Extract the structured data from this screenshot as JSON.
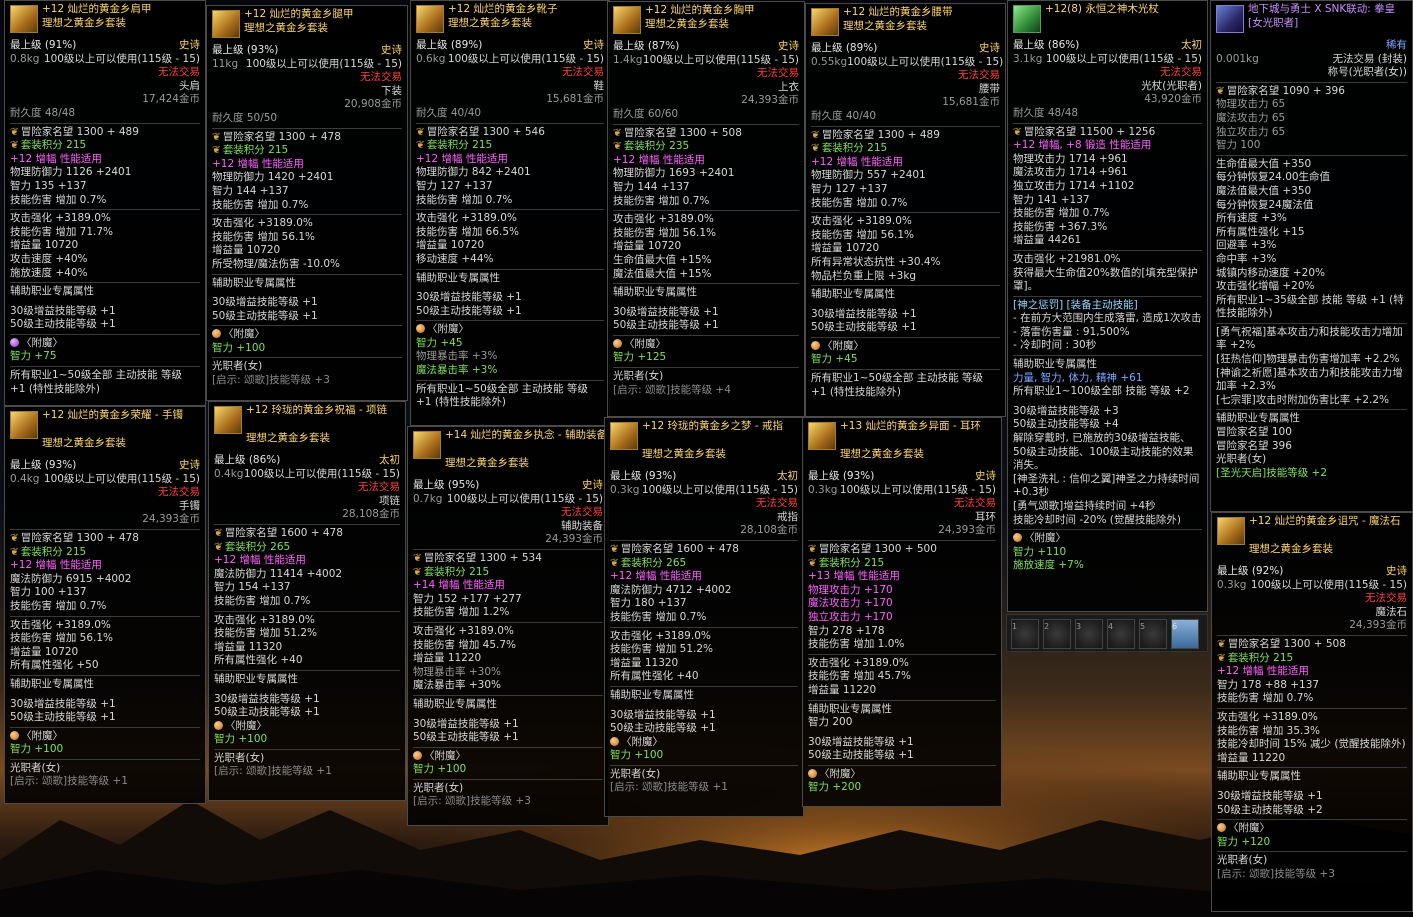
{
  "tooltips": [
    {
      "id": "shoulder",
      "name": "+12 灿烂的黄金乡肩甲",
      "set": "理想之黄金乡套装",
      "icon": "gold-armor-icon",
      "rarity": "史诗",
      "grade": "最上级 (91%)",
      "weight": "0.8kg",
      "level_req": "100级以上可以使用(115级 - 15)",
      "trade": "无法交易",
      "slot": "头肩",
      "price": "17,424金币",
      "durability": "耐久度 48/48",
      "fame": "冒险家名望 1300 + 489",
      "setpoints": "套装积分 215",
      "enhance": "+12 增幅 性能适用",
      "defense": "物理防御力 1126 +2401",
      "int": "智力 135 +137",
      "skill_dmg": "技能伤害 增加 0.7%",
      "stats": [
        "攻击强化 +3189.0%",
        "技能伤害 增加 71.7%",
        "增益量 10720",
        "攻击速度 +40%",
        "施放速度 +40%"
      ],
      "buffer_title": "辅助职业专属属性",
      "buffer": [
        "30级增益技能等级 +1",
        "50级主动技能等级 +1"
      ],
      "enchant": "〈附魔〉",
      "enchant_val": "智力 +75",
      "extra": "所有职业1~50级全部 主动技能 等级 +1 (特性技能除外)",
      "class": "",
      "hint": ""
    },
    {
      "id": "legs",
      "name": "+12 灿烂的黄金乡腿甲",
      "set": "理想之黄金乡套装",
      "rarity": "史诗",
      "grade": "最上级 (93%)",
      "weight": "11kg",
      "level_req": "100级以上可以使用(115级 - 15)",
      "trade": "无法交易",
      "slot": "下装",
      "price": "20,908金币",
      "durability": "耐久度 50/50",
      "fame": "冒险家名望 1300 + 478",
      "setpoints": "套装积分 215",
      "enhance": "+12 增幅 性能适用",
      "defense": "物理防御力 1420 +2401",
      "int": "智力 144 +137",
      "skill_dmg": "技能伤害 增加 0.7%",
      "stats": [
        "攻击强化 +3189.0%",
        "技能伤害 增加 56.1%",
        "增益量 10720",
        "所受物理/魔法伤害 -10.0%"
      ],
      "buffer_title": "辅助职业专属属性",
      "buffer": [
        "30级增益技能等级 +1",
        "50级主动技能等级 +1"
      ],
      "enchant": "〈附魔〉",
      "enchant_val": "智力 +100",
      "class": "光职者(女)",
      "hint": "[启示: 颂歌]技能等级 +3"
    },
    {
      "id": "boots",
      "name": "+12 灿烂的黄金乡靴子",
      "set": "理想之黄金乡套装",
      "rarity": "史诗",
      "grade": "最上级 (89%)",
      "weight": "0.6kg",
      "level_req": "100级以上可以使用(115级 - 15)",
      "trade": "无法交易",
      "slot": "鞋",
      "price": "15,681金币",
      "durability": "耐久度 40/40",
      "fame": "冒险家名望 1300 + 546",
      "setpoints": "套装积分 215",
      "enhance": "+12 增幅 性能适用",
      "defense": "物理防御力 842 +2401",
      "int": "智力 127 +137",
      "skill_dmg": "技能伤害 增加 0.7%",
      "stats": [
        "攻击强化 +3189.0%",
        "技能伤害 增加 66.5%",
        "增益量 10720",
        "移动速度 +44%"
      ],
      "buffer_title": "辅助职业专属属性",
      "buffer": [
        "30级增益技能等级 +1",
        "50级主动技能等级 +1"
      ],
      "enchant": "〈附魔〉",
      "enchant_val": "智力 +45",
      "enchant_extra": [
        "物理暴击率 +3%",
        "魔法暴击率 +3%"
      ],
      "extra": "所有职业1~50级全部 主动技能 等级 +1 (特性技能除外)"
    },
    {
      "id": "chest",
      "name": "+12 灿烂的黄金乡胸甲",
      "set": "理想之黄金乡套装",
      "rarity": "史诗",
      "grade": "最上级 (87%)",
      "weight": "1.4kg",
      "level_req": "100级以上可以使用(115级 - 15)",
      "trade": "无法交易",
      "slot": "上衣",
      "price": "24,393金币",
      "durability": "耐久度 60/60",
      "fame": "冒险家名望 1300 + 508",
      "setpoints": "套装积分 235",
      "enhance": "+12 增幅 性能适用",
      "defense": "物理防御力 1693 +2401",
      "int": "智力 144 +137",
      "skill_dmg": "技能伤害 增加 0.7%",
      "stats": [
        "攻击强化 +3189.0%",
        "技能伤害 增加 56.1%",
        "增益量 10720",
        "生命值最大值 +15%",
        "魔法值最大值 +15%"
      ],
      "buffer_title": "辅助职业专属属性",
      "buffer": [
        "30级增益技能等级 +1",
        "50级主动技能等级 +1"
      ],
      "enchant": "〈附魔〉",
      "enchant_val": "智力 +125",
      "class": "光职者(女)",
      "hint": "[启示: 颂歌]技能等级 +4"
    },
    {
      "id": "belt",
      "name": "+12 灿烂的黄金乡腰带",
      "set": "理想之黄金乡套装",
      "rarity": "史诗",
      "grade": "最上级 (89%)",
      "weight": "0.55kg",
      "level_req": "100级以上可以使用(115级 - 15)",
      "trade": "无法交易",
      "slot": "腰带",
      "price": "15,681金币",
      "durability": "耐久度 40/40",
      "fame": "冒险家名望 1300 + 489",
      "setpoints": "套装积分 215",
      "enhance": "+12 增幅 性能适用",
      "defense": "物理防御力 557 +2401",
      "int": "智力 127 +137",
      "skill_dmg": "技能伤害 增加 0.7%",
      "stats": [
        "攻击强化 +3189.0%",
        "技能伤害 增加 56.1%",
        "增益量 10720",
        "所有异常状态抗性 +30.4%",
        "物品栏负重上限 +3kg"
      ],
      "buffer_title": "辅助职业专属属性",
      "buffer": [
        "30级增益技能等级 +1",
        "50级主动技能等级 +1"
      ],
      "enchant": "〈附魔〉",
      "enchant_val": "智力 +45",
      "extra": "所有职业1~50级全部 主动技能 等级 +1 (特性技能除外)"
    },
    {
      "id": "weapon",
      "name": "+12(8) 永恒之神木光杖",
      "rarity": "太初",
      "grade": "最上级 (86%)",
      "weight": "3.1kg",
      "level_req": "100级以上可以使用(115级 - 15)",
      "trade": "无法交易",
      "slot": "光杖(光职者)",
      "price": "43,920金币",
      "durability": "耐久度 48/48",
      "fame": "冒险家名望 11500 + 1256",
      "enhance": "+12 增幅, +8 锻造 性能适用",
      "atk": [
        "物理攻击力 1714 +961",
        "魔法攻击力 1714 +961",
        "独立攻击力 1714 +1102"
      ],
      "int": "智力 141 +137",
      "skill_dmg": "技能伤害 增加 0.7%",
      "skill_dmg2": "技能伤害 +367.3%",
      "buff": "增益量 44261",
      "stats": [
        "攻击强化 +21981.0%",
        "获得最大生命值20%数值的[填充型保护罩]。"
      ],
      "active_title": "[神之惩罚] [装备主动技能]",
      "active": [
        "- 在前方大范围内生成落雷, 造成1次攻击",
        "- 落雷伤害量 : 91,500%",
        "- 冷却时间 : 30秒"
      ],
      "buffer_title": "辅助职业专属属性",
      "buffer_stat": "力量, 智力, 体力, 精神 +61",
      "buffer_skill": "所有职业1~100级全部 技能 等级 +2",
      "buffer": [
        "30级增益技能等级 +3",
        "50级主动技能等级 +4"
      ],
      "notes": [
        "解除穿戴时, 已施放的30级增益技能、50级主动技能、100级主动技能的效果消失。",
        "[神圣洗礼 : 信仰之翼]神圣之力持续时间 +0.3秒",
        "[勇气颂歌]增益持续时间 +4秒",
        "技能冷却时间 -20% (觉醒技能除外)"
      ],
      "enchant": "〈附魔〉",
      "enchant_val": "智力 +110",
      "enchant_extra": [
        "施放速度 +7%"
      ]
    },
    {
      "id": "title",
      "name": "地下城与勇士 X SNK联动: 拳皇[女光职者]",
      "rarity": "稀有",
      "weight": "0.001kg",
      "trade": "无法交易 (封装)",
      "slot": "称号(光职者(女))",
      "fame": "冒险家名望 1090 + 396",
      "atk": [
        "物理攻击力 65",
        "魔法攻击力 65",
        "独立攻击力 65",
        "智力 100"
      ],
      "stats": [
        "生命值最大值 +350",
        "每分钟恢复24.00生命值",
        "魔法值最大值 +350",
        "每分钟恢复24魔法值",
        "所有速度 +3%",
        "所有属性强化 +15",
        "回避率 +3%",
        "命中率 +3%",
        "城镇内移动速度 +20%",
        "攻击强化增幅 +20%",
        "所有职业1~35级全部 技能 等级 +1 (特性技能除外)"
      ],
      "notes": [
        "[勇气祝福]基本攻击力和技能攻击力增加率 +2%",
        "[狂热信仰]物理暴击伤害增加率 +2.2%",
        "[神谕之祈愿]基本攻击力和技能攻击力增加率 +2.3%",
        "[七宗罪]攻击时附加伤害比率 +2.2%"
      ],
      "buffer_title": "辅助职业专属属性",
      "buffer": [
        "冒险家名望 100"
      ],
      "fame2": "冒险家名望 396",
      "class": "光职者(女)",
      "hint": "[圣光天启]技能等级 +2"
    },
    {
      "id": "wrist",
      "name": "+12 灿烂的黄金乡荣耀 - 手镯",
      "set": "理想之黄金乡套装",
      "rarity": "史诗",
      "grade": "最上级 (93%)",
      "weight": "0.4kg",
      "level_req": "100级以上可以使用(115级 - 15)",
      "trade": "无法交易",
      "slot": "手镯",
      "price": "24,393金币",
      "fame": "冒险家名望 1300 + 478",
      "setpoints": "套装积分 215",
      "enhance": "+12 增幅 性能适用",
      "defense": "魔法防御力 6915 +4002",
      "int": "智力 100 +137",
      "skill_dmg": "技能伤害 增加 0.7%",
      "stats": [
        "攻击强化 +3189.0%",
        "技能伤害 增加 56.1%",
        "增益量 10720",
        "所有属性强化 +50"
      ],
      "buffer_title": "辅助职业专属属性",
      "buffer": [
        "30级增益技能等级 +1",
        "50级主动技能等级 +1"
      ],
      "enchant": "〈附魔〉",
      "enchant_val": "智力 +100",
      "class": "光职者(女)",
      "hint": "[启示: 颂歌]技能等级 +1"
    },
    {
      "id": "neck",
      "name": "+12 玲珑的黄金乡祝福 - 项链",
      "set": "理想之黄金乡套装",
      "rarity": "太初",
      "grade": "最上级 (86%)",
      "weight": "0.4kg",
      "level_req": "100级以上可以使用(115级 - 15)",
      "trade": "无法交易",
      "slot": "项链",
      "price": "28,108金币",
      "fame": "冒险家名望 1600 + 478",
      "setpoints": "套装积分 265",
      "enhance": "+12 增幅 性能适用",
      "defense": "魔法防御力 11414 +4002",
      "int": "智力 154 +137",
      "skill_dmg": "技能伤害 增加 0.7%",
      "stats": [
        "攻击强化 +3189.0%",
        "技能伤害 增加 51.2%",
        "增益量 11320",
        "所有属性强化 +40"
      ],
      "buffer_title": "辅助职业专属属性",
      "buffer": [
        "30级增益技能等级 +1",
        "50级主动技能等级 +1"
      ],
      "enchant": "〈附魔〉",
      "enchant_val": "智力 +100",
      "class": "光职者(女)",
      "hint": "[启示: 颂歌]技能等级 +1"
    },
    {
      "id": "support",
      "name": "+14 灿烂的黄金乡执念 - 辅助装备",
      "set": "理想之黄金乡套装",
      "rarity": "史诗",
      "grade": "最上级 (95%)",
      "weight": "0.7kg",
      "level_req": "100级以上可以使用(115级 - 15)",
      "trade": "无法交易",
      "slot": "辅助装备",
      "price": "24,393金币",
      "fame": "冒险家名望 1300 + 534",
      "setpoints": "套装积分 215",
      "enhance": "+14 增幅 性能适用",
      "int": "智力 152 +177 +277",
      "skill_dmg": "技能伤害 增加 1.2%",
      "stats": [
        "攻击强化 +3189.0%",
        "技能伤害 增加 45.7%",
        "增益量 11220"
      ],
      "dim": "物理暴击率 +30%",
      "stats2": [
        "魔法暴击率 +30%"
      ],
      "buffer_title": "辅助职业专属属性",
      "buffer": [
        "30级增益技能等级 +1",
        "50级主动技能等级 +1"
      ],
      "enchant": "〈附魔〉",
      "enchant_val": "智力 +100",
      "class": "光职者(女)",
      "hint": "[启示: 颂歌]技能等级 +3"
    },
    {
      "id": "ring",
      "name": "+12 玲珑的黄金乡之梦 - 戒指",
      "set": "理想之黄金乡套装",
      "rarity": "太初",
      "grade": "最上级 (93%)",
      "weight": "0.3kg",
      "level_req": "100级以上可以使用(115级 - 15)",
      "trade": "无法交易",
      "slot": "戒指",
      "price": "28,108金币",
      "fame": "冒险家名望 1600 + 478",
      "setpoints": "套装积分 265",
      "enhance": "+12 增幅 性能适用",
      "defense": "魔法防御力 4712 +4002",
      "int": "智力 180 +137",
      "skill_dmg": "技能伤害 增加 0.7%",
      "stats": [
        "攻击强化 +3189.0%",
        "技能伤害 增加 51.2%",
        "增益量 11320",
        "所有属性强化 +40"
      ],
      "buffer_title": "辅助职业专属属性",
      "buffer": [
        "30级增益技能等级 +1",
        "50级主动技能等级 +1"
      ],
      "enchant": "〈附魔〉",
      "enchant_val": "智力 +100",
      "class": "光职者(女)",
      "hint": "[启示: 颂歌]技能等级 +1"
    },
    {
      "id": "earring",
      "name": "+13 灿烂的黄金乡异面 - 耳环",
      "set": "理想之黄金乡套装",
      "rarity": "史诗",
      "grade": "最上级 (93%)",
      "weight": "0.3kg",
      "level_req": "100级以上可以使用(115级 - 15)",
      "trade": "无法交易",
      "slot": "耳环",
      "price": "24,393金币",
      "fame": "冒险家名望 1300 + 500",
      "setpoints": "套装积分 215",
      "enhance": "+13 增幅 性能适用",
      "atk": [
        "物理攻击力 +170",
        "魔法攻击力 +170",
        "独立攻击力 +170"
      ],
      "int": "智力 278 +178",
      "skill_dmg": "技能伤害 增加 1.0%",
      "stats": [
        "攻击强化 +3189.0%",
        "技能伤害 增加 45.7%",
        "增益量 11220"
      ],
      "buffer_title": "辅助职业专属属性",
      "buffer_stat": "智力 200",
      "buffer": [
        "30级增益技能等级 +1",
        "50级主动技能等级 +1"
      ],
      "enchant": "〈附魔〉",
      "enchant_val": "智力 +200"
    },
    {
      "id": "stone",
      "name": "+12 灿烂的黄金乡诅咒 - 魔法石",
      "set": "理想之黄金乡套装",
      "rarity": "史诗",
      "grade": "最上级 (92%)",
      "weight": "0.3kg",
      "level_req": "100级以上可以使用(115级 - 15)",
      "trade": "无法交易",
      "slot": "魔法石",
      "price": "24,393金币",
      "fame": "冒险家名望 1300 + 508",
      "setpoints": "套装积分 215",
      "enhance": "+12 增幅 性能适用",
      "int": "智力 178 +88 +137",
      "skill_dmg": "技能伤害 增加 0.7%",
      "stats": [
        "攻击强化 +3189.0%",
        "技能伤害 增加 35.3%",
        "技能冷却时间 15% 减少 (觉醒技能除外)",
        "增益量 11220"
      ],
      "buffer_title": "辅助职业专属属性",
      "buffer": [
        "30级增益技能等级 +1",
        "50级主动技能等级 +2"
      ],
      "enchant": "〈附魔〉",
      "enchant_val": "智力 +120",
      "class": "光职者(女)",
      "hint": "[启示: 颂歌]技能等级 +3"
    }
  ],
  "hotbar": {
    "keys": [
      "1",
      "2",
      "3",
      "4",
      "5",
      "6"
    ]
  }
}
